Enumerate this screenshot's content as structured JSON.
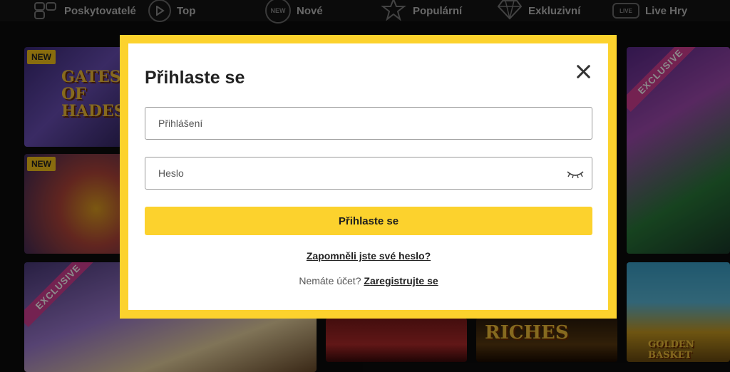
{
  "nav": {
    "items": [
      {
        "label": "Poskytovatelé",
        "icon": "grid-icon"
      },
      {
        "label": "Top",
        "icon": "play-icon"
      },
      {
        "label": "Nové",
        "icon": "new-icon",
        "icon_text": "NEW"
      },
      {
        "label": "Populární",
        "icon": "star-icon"
      },
      {
        "label": "Exkluzivní",
        "icon": "diamond-icon"
      },
      {
        "label": "Live Hry",
        "icon": "live-icon",
        "icon_text": "LIVE"
      }
    ]
  },
  "tiles": {
    "badge_new": "NEW",
    "ribbon_exclusive": "EXCLUSIVE",
    "gates_title": "GATES OF HADES",
    "riches_title": "RICHES",
    "golden_title": "GOLDEN BASKET"
  },
  "modal": {
    "title": "Přihlaste se",
    "login_placeholder": "Přihlášení",
    "password_placeholder": "Heslo",
    "submit_label": "Přihlaste se",
    "forgot_label": "Zapomněli jste své heslo?",
    "no_account_text": "Nemáte účet?",
    "register_label": "Zaregistrujte se"
  },
  "colors": {
    "accent": "#fcd22d",
    "badge": "#f7c51b",
    "ribbon": "#d43f94"
  }
}
